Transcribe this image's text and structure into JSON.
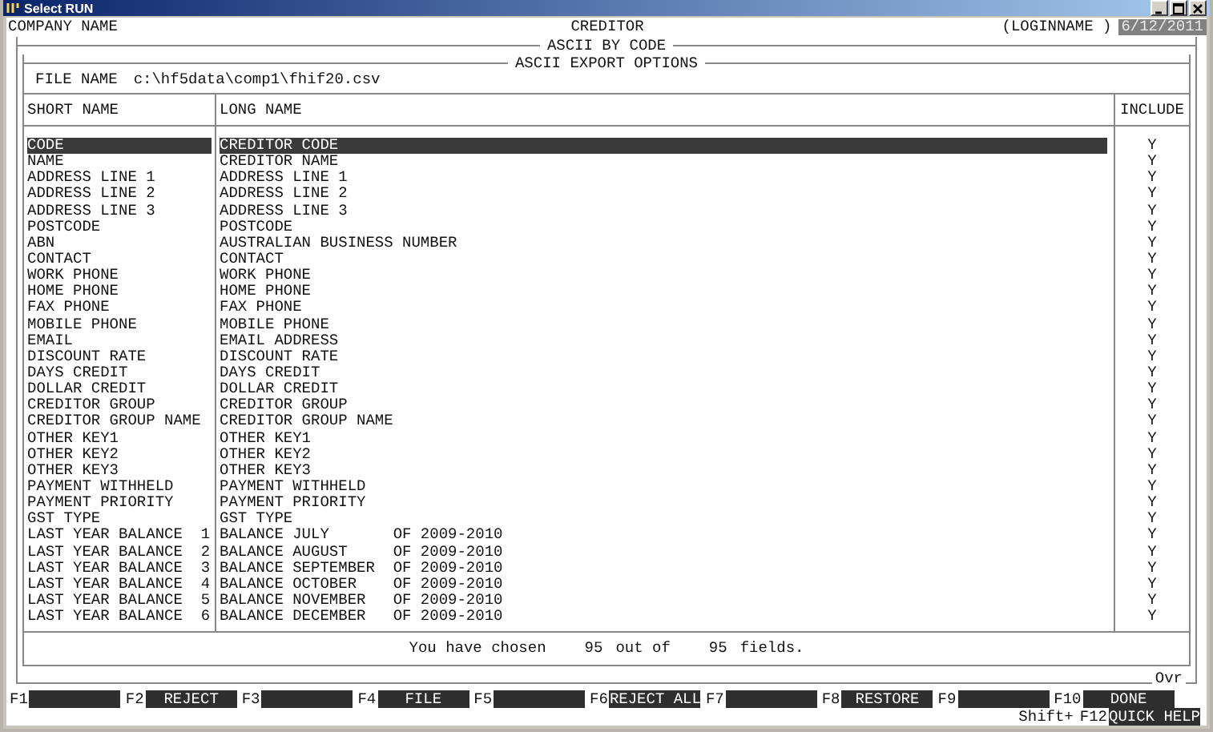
{
  "window": {
    "title": "Select RUN"
  },
  "header": {
    "company": "COMPANY NAME",
    "module": "CREDITOR",
    "login": "(LOGINNAME )",
    "date": "6/12/2011"
  },
  "section_title": "ASCII BY CODE",
  "panel_title": "ASCII EXPORT OPTIONS",
  "file_name": {
    "label": "FILE NAME",
    "value": "c:\\hf5data\\comp1\\fhif20.csv"
  },
  "table": {
    "columns": [
      "SHORT NAME",
      "LONG NAME",
      "INCLUDE"
    ],
    "rows": [
      {
        "short": "CODE",
        "long": "CREDITOR CODE",
        "include": "Y",
        "selected": true
      },
      {
        "short": "NAME",
        "long": "CREDITOR NAME",
        "include": "Y",
        "selected": false
      },
      {
        "short": "ADDRESS LINE 1",
        "long": "ADDRESS LINE 1",
        "include": "Y",
        "selected": false
      },
      {
        "short": "ADDRESS LINE 2",
        "long": "ADDRESS LINE 2",
        "include": "Y",
        "selected": false
      },
      {
        "short": "ADDRESS LINE 3",
        "long": "ADDRESS LINE 3",
        "include": "Y",
        "selected": false
      },
      {
        "short": "POSTCODE",
        "long": "POSTCODE",
        "include": "Y",
        "selected": false
      },
      {
        "short": "ABN",
        "long": "AUSTRALIAN BUSINESS NUMBER",
        "include": "Y",
        "selected": false
      },
      {
        "short": "CONTACT",
        "long": "CONTACT",
        "include": "Y",
        "selected": false
      },
      {
        "short": "WORK PHONE",
        "long": "WORK PHONE",
        "include": "Y",
        "selected": false
      },
      {
        "short": "HOME PHONE",
        "long": "HOME PHONE",
        "include": "Y",
        "selected": false
      },
      {
        "short": "FAX PHONE",
        "long": "FAX PHONE",
        "include": "Y",
        "selected": false
      },
      {
        "short": "MOBILE PHONE",
        "long": "MOBILE PHONE",
        "include": "Y",
        "selected": false
      },
      {
        "short": "EMAIL",
        "long": "EMAIL ADDRESS",
        "include": "Y",
        "selected": false
      },
      {
        "short": "DISCOUNT RATE",
        "long": "DISCOUNT RATE",
        "include": "Y",
        "selected": false
      },
      {
        "short": "DAYS CREDIT",
        "long": "DAYS CREDIT",
        "include": "Y",
        "selected": false
      },
      {
        "short": "DOLLAR CREDIT",
        "long": "DOLLAR CREDIT",
        "include": "Y",
        "selected": false
      },
      {
        "short": "CREDITOR GROUP",
        "long": "CREDITOR GROUP",
        "include": "Y",
        "selected": false
      },
      {
        "short": "CREDITOR GROUP NAME",
        "long": "CREDITOR GROUP NAME",
        "include": "Y",
        "selected": false
      },
      {
        "short": "OTHER KEY1",
        "long": "OTHER KEY1",
        "include": "Y",
        "selected": false
      },
      {
        "short": "OTHER KEY2",
        "long": "OTHER KEY2",
        "include": "Y",
        "selected": false
      },
      {
        "short": "OTHER KEY3",
        "long": "OTHER KEY3",
        "include": "Y",
        "selected": false
      },
      {
        "short": "PAYMENT WITHHELD",
        "long": "PAYMENT WITHHELD",
        "include": "Y",
        "selected": false
      },
      {
        "short": "PAYMENT PRIORITY",
        "long": "PAYMENT PRIORITY",
        "include": "Y",
        "selected": false
      },
      {
        "short": "GST TYPE",
        "long": "GST TYPE",
        "include": "Y",
        "selected": false
      },
      {
        "short": "LAST YEAR BALANCE  1",
        "long": "BALANCE JULY       OF 2009-2010",
        "include": "Y",
        "selected": false
      },
      {
        "short": "LAST YEAR BALANCE  2",
        "long": "BALANCE AUGUST     OF 2009-2010",
        "include": "Y",
        "selected": false
      },
      {
        "short": "LAST YEAR BALANCE  3",
        "long": "BALANCE SEPTEMBER  OF 2009-2010",
        "include": "Y",
        "selected": false
      },
      {
        "short": "LAST YEAR BALANCE  4",
        "long": "BALANCE OCTOBER    OF 2009-2010",
        "include": "Y",
        "selected": false
      },
      {
        "short": "LAST YEAR BALANCE  5",
        "long": "BALANCE NOVEMBER   OF 2009-2010",
        "include": "Y",
        "selected": false
      },
      {
        "short": "LAST YEAR BALANCE  6",
        "long": "BALANCE DECEMBER   OF 2009-2010",
        "include": "Y",
        "selected": false
      }
    ]
  },
  "summary": {
    "prefix": "You have chosen",
    "chosen": "95",
    "middle": "out of",
    "total": "95",
    "suffix": "fields."
  },
  "mode": "Ovr",
  "function_keys": [
    {
      "key": "F1"
    },
    {
      "key": "F2",
      "label": "REJECT"
    },
    {
      "key": "F3"
    },
    {
      "key": "F4",
      "label": "FILE"
    },
    {
      "key": "F5"
    },
    {
      "key": "F6",
      "label": "REJECT ALL"
    },
    {
      "key": "F7"
    },
    {
      "key": "F8",
      "label": "RESTORE"
    },
    {
      "key": "F9"
    },
    {
      "key": "F10",
      "label": "DONE"
    }
  ],
  "shift_keys": {
    "prefix": "Shift+",
    "keys": [
      {
        "key": "F12",
        "label": "QUICK HELP"
      }
    ]
  }
}
